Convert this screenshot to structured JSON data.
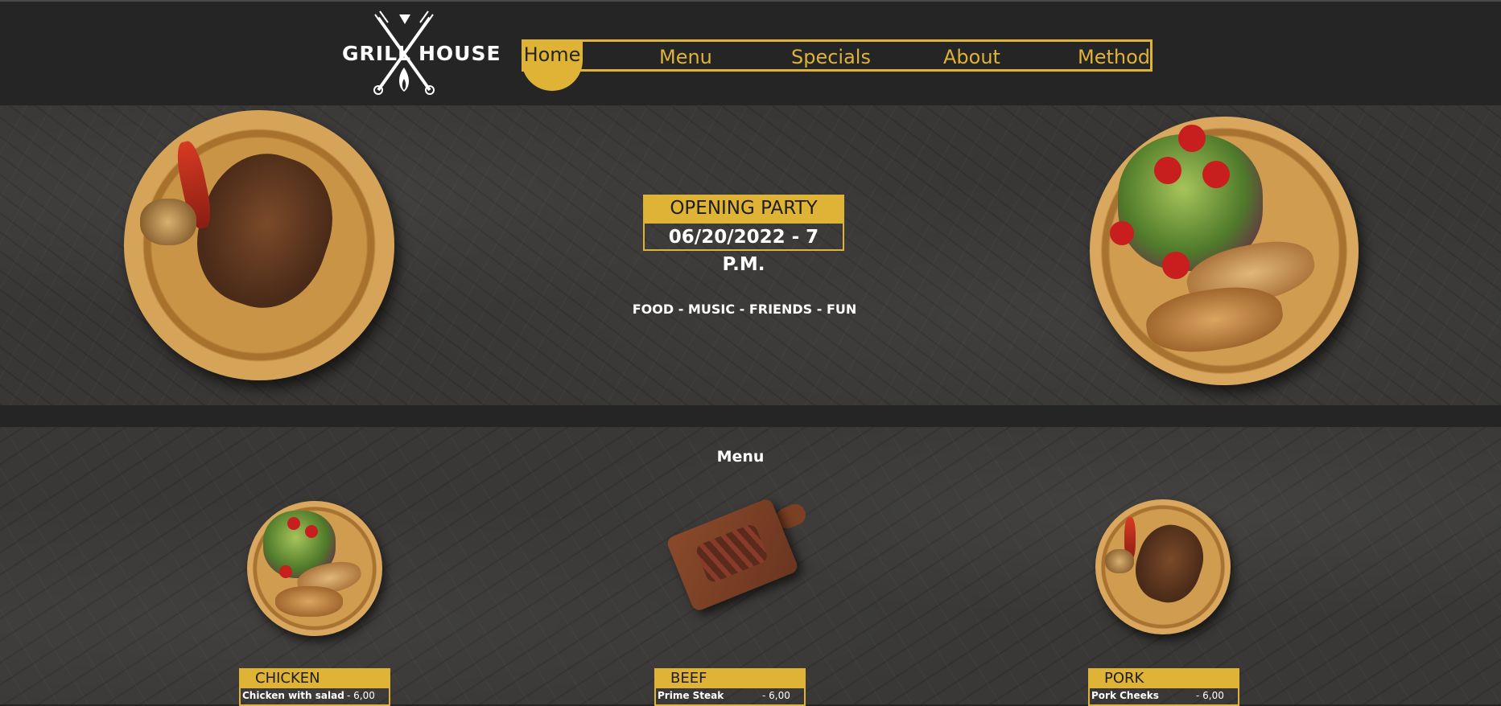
{
  "header": {
    "logo": {
      "left": "GRILL",
      "right": "HOUSE"
    },
    "nav": [
      {
        "label": "Home",
        "active": true
      },
      {
        "label": "Menu",
        "active": false
      },
      {
        "label": "Specials",
        "active": false
      },
      {
        "label": "About",
        "active": false
      },
      {
        "label": "Method",
        "active": false
      }
    ]
  },
  "hero": {
    "title": "OPENING PARTY",
    "date": "06/20/2022 - 7 P.M.",
    "tagline": "FOOD - MUSIC - FRIENDS - FUN"
  },
  "menu": {
    "heading": "Menu",
    "cards": [
      {
        "title": "CHICKEN",
        "dish": "Chicken with salad",
        "price": "- 6,00"
      },
      {
        "title": "BEEF",
        "dish": "Prime Steak",
        "price": "- 6,00"
      },
      {
        "title": "PORK",
        "dish": "Pork Cheeks",
        "price": "- 6,00"
      }
    ]
  },
  "colors": {
    "accent": "#dfb335",
    "background": "#252525",
    "stone": "#383735",
    "text": "#ffffff"
  }
}
